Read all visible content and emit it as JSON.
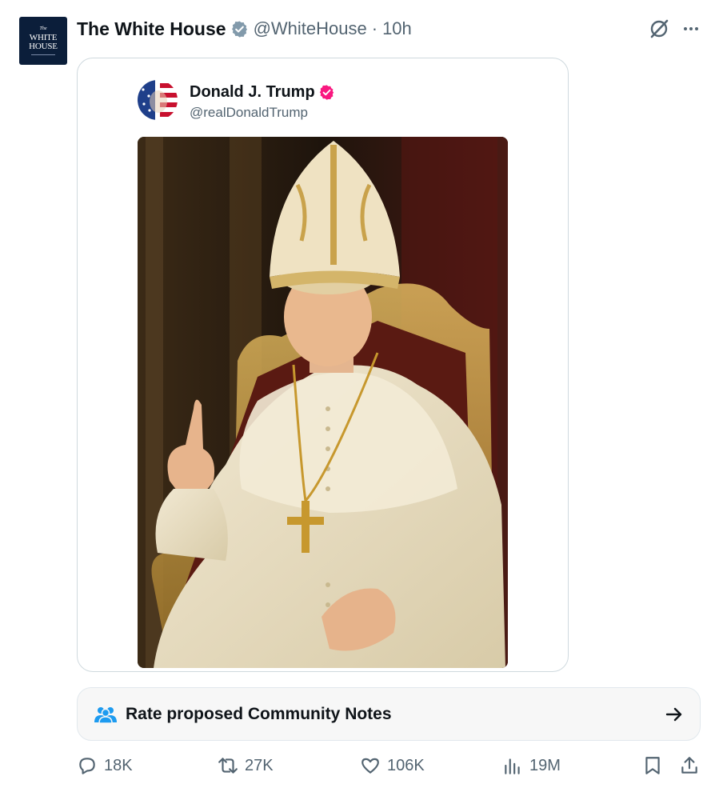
{
  "tweet": {
    "author_name": "The White House",
    "handle": "@WhiteHouse",
    "separator": "·",
    "time": "10h",
    "avatar_logo": {
      "line1": "The",
      "line2": "WHITE",
      "line3": "HOUSE"
    }
  },
  "quoted": {
    "author_name": "Donald J. Trump",
    "handle": "@realDonaldTrump"
  },
  "community_notes": {
    "label": "Rate proposed Community Notes"
  },
  "actions": {
    "replies": "18K",
    "reposts": "27K",
    "likes": "106K",
    "views": "19M"
  },
  "colors": {
    "verified_gray": "#829aab",
    "verified_pink": "#f91880",
    "secondary_text": "#536471",
    "border": "#cfd9de",
    "avatar_navy": "#0b1e3a",
    "community_icon": "#1d9bf0"
  },
  "icons": [
    "grok-icon",
    "more-icon",
    "verified-badge-icon",
    "community-icon",
    "arrow-right-icon",
    "reply-icon",
    "repost-icon",
    "like-icon",
    "views-icon",
    "bookmark-icon",
    "share-icon"
  ]
}
